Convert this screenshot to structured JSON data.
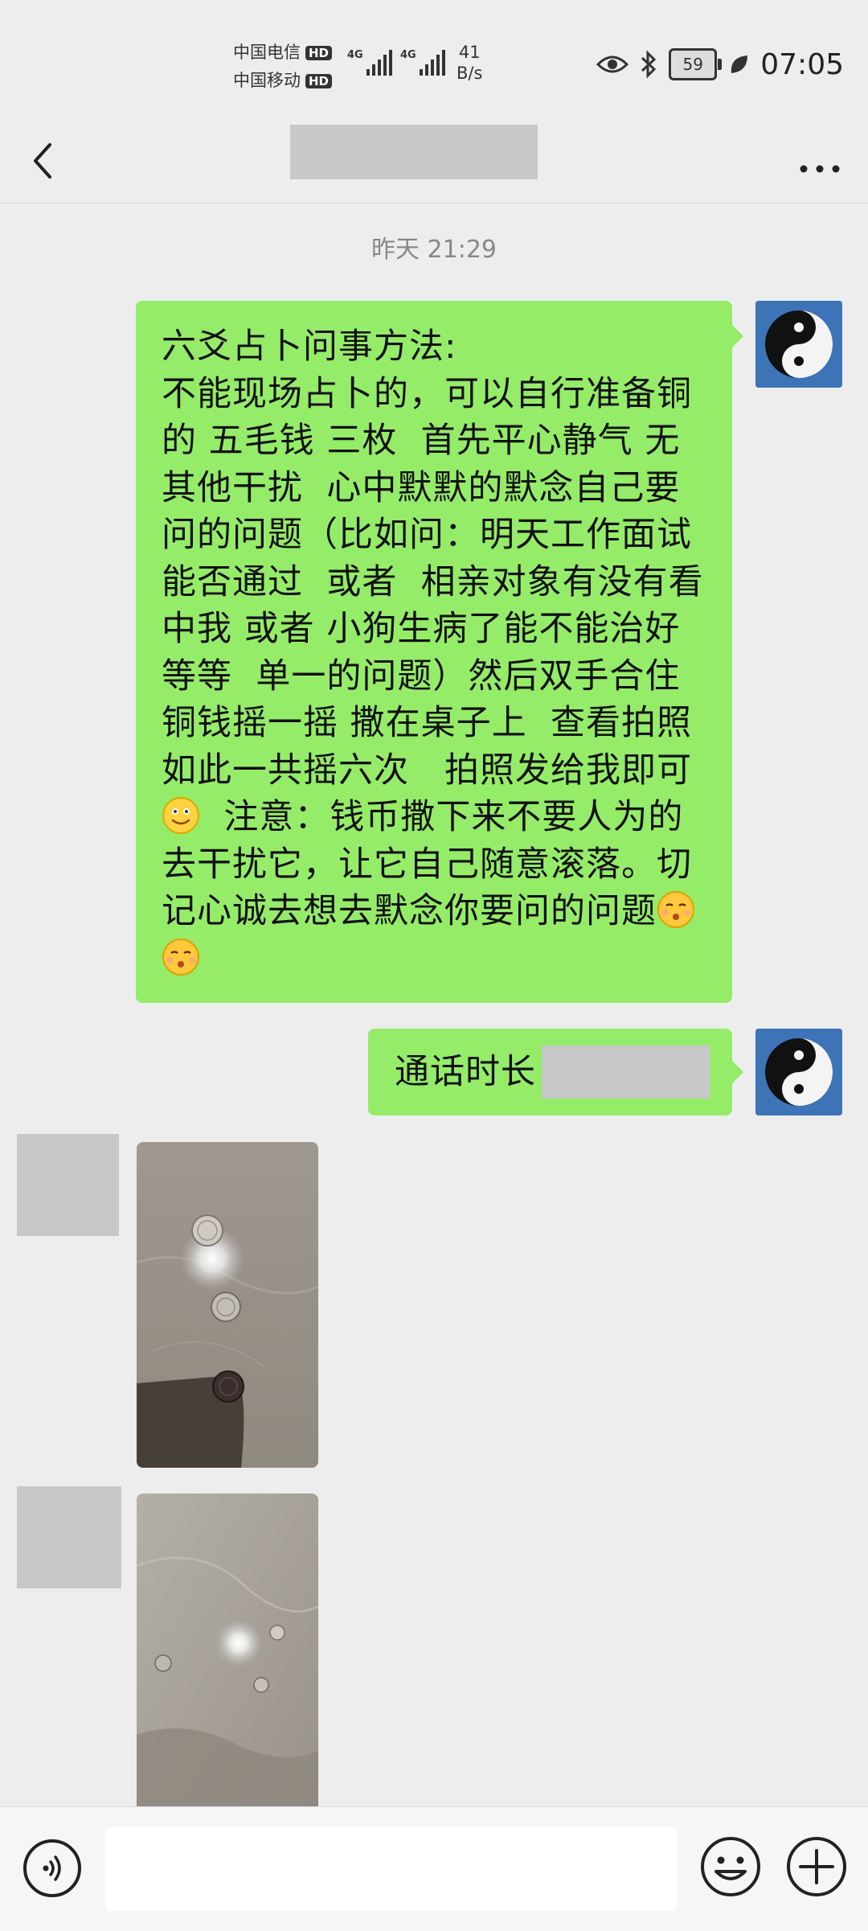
{
  "status_bar": {
    "carrier1": "中国电信",
    "carrier2": "中国移动",
    "hd": "HD",
    "net1": "4G",
    "net2": "4G",
    "speed_value": "41",
    "speed_unit": "B/s",
    "battery": "59",
    "time": "07:05"
  },
  "chat": {
    "timestamp": "昨天 21:29",
    "messages": [
      {
        "sender": "me",
        "type": "text",
        "text": "六爻占卜问事方法:\n不能现场占卜的，可以自行准备铜的 五毛钱 三枚  首先平心静气 无其他干扰  心中默默的默念自己要问的问题（比如问：明天工作面试能否通过  或者  相亲对象有没有看中我 或者 小狗生病了能不能治好等等  单一的问题）然后双手合住铜钱摇一摇 撒在桌子上  查看拍照  如此一共摇六次   拍照发给我即可",
        "text_after_smile": "  注意：钱币撒下来不要人为的去干扰它，让它自己随意滚落。切记心诚去想去默念你要问的问题"
      },
      {
        "sender": "me",
        "type": "call",
        "text": "通话时长"
      },
      {
        "sender": "other",
        "type": "image",
        "label": "photo-coins-1"
      },
      {
        "sender": "other",
        "type": "image",
        "label": "photo-coins-2"
      }
    ]
  },
  "input": {
    "value": "",
    "placeholder": ""
  },
  "colors": {
    "bubble": "#95ec69",
    "background": "#ededed",
    "avatar": "#3d74b8"
  },
  "icons": [
    "back-icon",
    "more-icon",
    "voice-icon",
    "emoji-icon",
    "plus-icon",
    "yin-yang-icon",
    "smile-emoji",
    "shush-emoji"
  ]
}
